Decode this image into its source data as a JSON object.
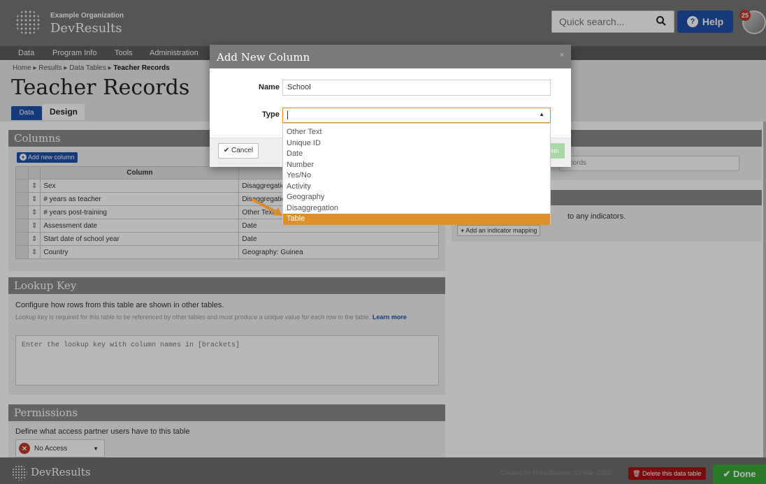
{
  "header": {
    "org": "Example Organization",
    "app": "DevResults",
    "search_placeholder": "Quick search...",
    "help": "Help",
    "notifications": "25"
  },
  "nav": [
    "Data",
    "Program Info",
    "Tools",
    "Administration"
  ],
  "breadcrumb": {
    "home": "Home",
    "results": "Results",
    "data_tables": "Data Tables",
    "current": "Teacher Records"
  },
  "page": {
    "title": "Teacher Records",
    "tabs": [
      "Data",
      "Design"
    ]
  },
  "columns_panel": {
    "title": "Columns",
    "add_button": "Add new column",
    "header": "Column",
    "rows": [
      {
        "name": "Sex",
        "type": "Disaggregation"
      },
      {
        "name": "# years as teacher",
        "type": "Disaggregation"
      },
      {
        "name": "# years post-training",
        "type": "Other Text"
      },
      {
        "name": "Assessment date",
        "type": "Date"
      },
      {
        "name": "Start date of school year",
        "type": "Date"
      },
      {
        "name": "Country",
        "type": "Geography: Guinea"
      }
    ]
  },
  "lookup_panel": {
    "title": "Lookup Key",
    "description": "Configure how rows from this table are shown in other tables.",
    "help": "Lookup key is required for this table to be referenced by other tables and must produce a unique value for each row in the table.",
    "learn_more": "Learn more",
    "placeholder": "Enter the lookup key with column names in [brackets]"
  },
  "permissions_panel": {
    "title": "Permissions",
    "description": "Define what access partner users have to this table",
    "value": "No Access"
  },
  "right": {
    "input_text": "ecords",
    "mapping_text": "to any indicators.",
    "add_mapping": "Add an indicator mapping"
  },
  "footer": {
    "app": "DevResults",
    "credit": "Created by Riika Brasner (23 Mar 2019)",
    "delete": "Delete this data table",
    "done": "Done"
  },
  "modal": {
    "title": "Add New Column",
    "close": "×",
    "name_label": "Name",
    "name_value": "School",
    "type_label": "Type",
    "cancel": "Cancel",
    "save_partial": "mn",
    "options": [
      "Other Text",
      "Unique ID",
      "Date",
      "Number",
      "Yes/No",
      "Activity",
      "Geography",
      "Disaggregation",
      "Table"
    ],
    "selected_option": "Table"
  },
  "colors": {
    "accent_blue": "#1f4fa8",
    "highlight_orange": "#e0902a",
    "delete_red": "#a41414",
    "done_green": "#3aa83a"
  }
}
